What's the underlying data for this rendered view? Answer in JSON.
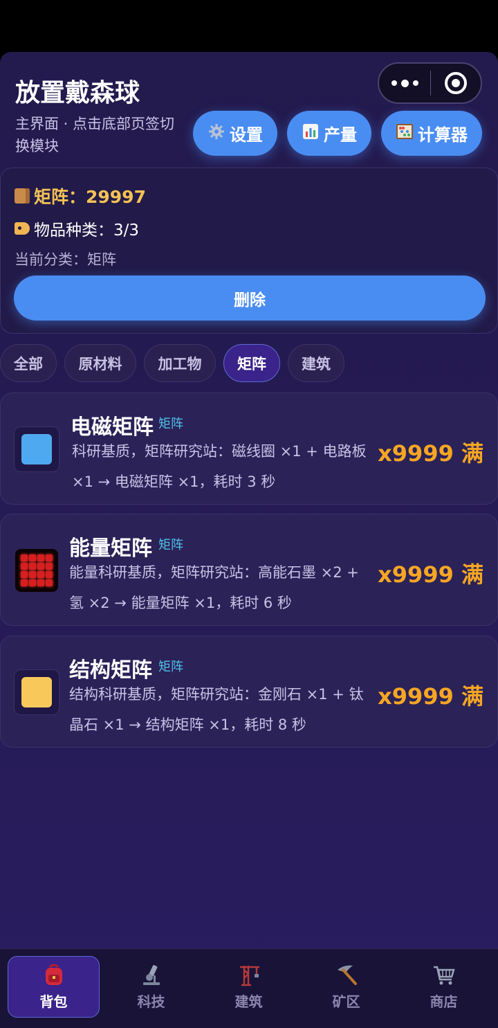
{
  "header": {
    "title": "放置戴森球",
    "subtitle": "主界面 · 点击底部页签切换模块",
    "buttons": [
      {
        "icon": "gear-icon",
        "label": "设置"
      },
      {
        "icon": "chart-icon",
        "label": "产量"
      },
      {
        "icon": "abacus-icon",
        "label": "计算器"
      }
    ]
  },
  "summary": {
    "matrix_text": "矩阵：29997",
    "kinds_text": "物品种类：3/3",
    "category_text": "当前分类：矩阵",
    "delete_label": "删除"
  },
  "tabs": [
    {
      "label": "全部",
      "active": false
    },
    {
      "label": "原材料",
      "active": false
    },
    {
      "label": "加工物",
      "active": false
    },
    {
      "label": "矩阵",
      "active": true
    },
    {
      "label": "建筑",
      "active": false
    }
  ],
  "items": [
    {
      "name": "电磁矩阵",
      "badge": "矩阵",
      "desc": "科研基质，矩阵研究站：磁线圈 ×1 + 电路板 ×1 → 电磁矩阵 ×1，耗时 3 秒",
      "count": "x9999 满",
      "icon_color": "#4fa9f0"
    },
    {
      "name": "能量矩阵",
      "badge": "矩阵",
      "desc": "能量科研基质，矩阵研究站：高能石墨 ×2 + 氢 ×2 → 能量矩阵 ×1，耗时 6 秒",
      "count": "x9999 满",
      "icon_color": "#d81e1e"
    },
    {
      "name": "结构矩阵",
      "badge": "矩阵",
      "desc": "结构科研基质，矩阵研究站：金刚石 ×1 + 钛晶石 ×1 → 结构矩阵 ×1，耗时 8 秒",
      "count": "x9999 满",
      "icon_color": "#f8c95a"
    }
  ],
  "nav": [
    {
      "label": "背包",
      "icon": "backpack-icon",
      "active": true
    },
    {
      "label": "科技",
      "icon": "microscope-icon",
      "active": false
    },
    {
      "label": "建筑",
      "icon": "crane-icon",
      "active": false
    },
    {
      "label": "矿区",
      "icon": "pickaxe-icon",
      "active": false
    },
    {
      "label": "商店",
      "icon": "cart-icon",
      "active": false
    }
  ]
}
